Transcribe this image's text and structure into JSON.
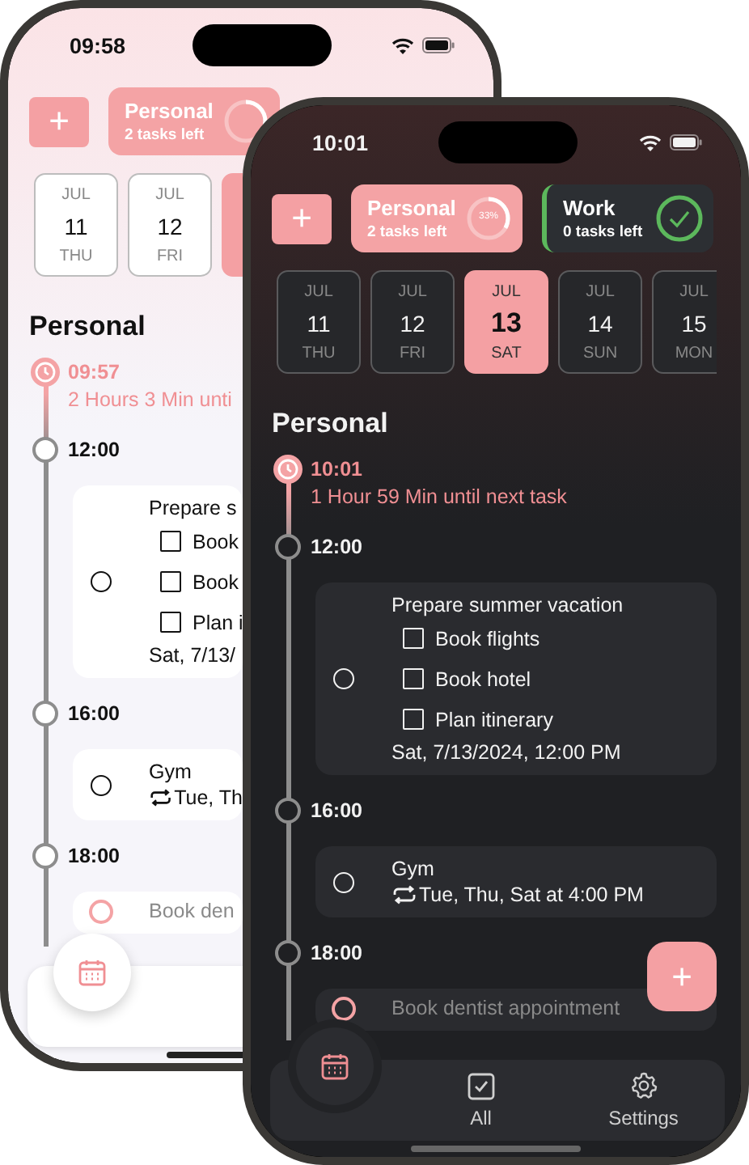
{
  "phones": [
    {
      "kind": "light",
      "status_time": "09:58",
      "add_label": "+",
      "lists": [
        {
          "name": "Personal",
          "count": "2 tasks left",
          "selected": true,
          "color": "#f4a3a5",
          "completed": false,
          "level": 0.33
        }
      ],
      "dates": [
        {
          "month": "JUL",
          "day": "11",
          "weekday": "THU",
          "selected": false
        },
        {
          "month": "JUL",
          "day": "12",
          "weekday": "FRI",
          "selected": false
        },
        {
          "selected": true
        }
      ],
      "heading": "Personal",
      "timeline": [
        {
          "kind": "now",
          "time": "09:57",
          "note": "2 Hours 3 Min unti"
        },
        {
          "kind": "hour",
          "time": "12:00"
        },
        {
          "kind": "task",
          "title": "Prepare s",
          "checked": false,
          "dimmed": false,
          "subtasks": [
            {
              "label": "Book",
              "checked": false
            },
            {
              "label": "Book",
              "checked": false
            },
            {
              "label": "Plan i",
              "checked": false
            }
          ],
          "date": "Sat, 7/13/"
        },
        {
          "kind": "hour",
          "time": "16:00"
        },
        {
          "kind": "task",
          "title": "Gym",
          "checked": false,
          "dimmed": false,
          "repeat": "Tue, Th"
        },
        {
          "kind": "hour",
          "time": "18:00"
        },
        {
          "kind": "task",
          "title": "Book den",
          "checked": false,
          "dimmed": true
        }
      ],
      "tabs": [
        {
          "kind": "calendar",
          "selected": true
        }
      ]
    },
    {
      "kind": "dark",
      "status_time": "10:01",
      "add_label": "+",
      "lists": [
        {
          "name": "Personal",
          "count": "2 tasks left",
          "selected": true,
          "color": "#f4a3a5",
          "completed": false,
          "level": 0.33,
          "percent": "33%"
        },
        {
          "name": "Work",
          "count": "0 tasks left",
          "selected": false,
          "color": "#5cb85c",
          "completed": true
        }
      ],
      "dates": [
        {
          "month": "JUL",
          "day": "11",
          "weekday": "THU",
          "selected": false
        },
        {
          "month": "JUL",
          "day": "12",
          "weekday": "FRI",
          "selected": false
        },
        {
          "month": "JUL",
          "day": "13",
          "weekday": "SAT",
          "selected": true
        },
        {
          "month": "JUL",
          "day": "14",
          "weekday": "SUN",
          "selected": false
        },
        {
          "month": "JUL",
          "day": "15",
          "weekday": "MON",
          "selected": false
        }
      ],
      "heading": "Personal",
      "timeline": [
        {
          "kind": "now",
          "time": "10:01",
          "note": "1 Hour 59 Min until next task"
        },
        {
          "kind": "hour",
          "time": "12:00"
        },
        {
          "kind": "task",
          "title": "Prepare summer vacation",
          "checked": false,
          "dimmed": false,
          "subtasks": [
            {
              "label": "Book flights",
              "checked": false
            },
            {
              "label": "Book hotel",
              "checked": false
            },
            {
              "label": "Plan itinerary",
              "checked": false
            }
          ],
          "date": "Sat, 7/13/2024, 12:00 PM"
        },
        {
          "kind": "hour",
          "time": "16:00"
        },
        {
          "kind": "task",
          "title": "Gym",
          "checked": false,
          "dimmed": false,
          "repeat": "Tue, Thu, Sat at 4:00 PM"
        },
        {
          "kind": "hour",
          "time": "18:00"
        },
        {
          "kind": "task",
          "title": "Book dentist appointment",
          "checked": false,
          "dimmed": true
        }
      ],
      "fab": "+",
      "tabs": [
        {
          "kind": "calendar",
          "selected": true
        },
        {
          "kind": "all",
          "label": "All",
          "selected": false
        },
        {
          "kind": "settings",
          "label": "Settings",
          "selected": false
        }
      ]
    }
  ]
}
